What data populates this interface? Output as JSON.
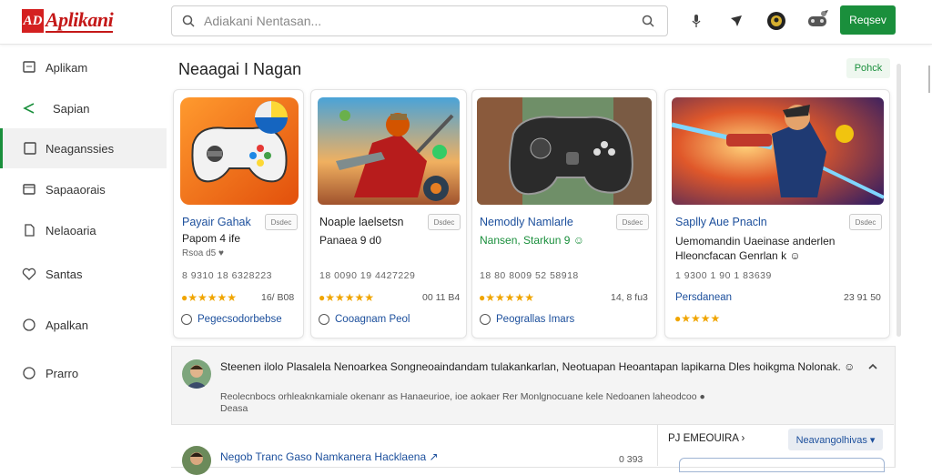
{
  "app": {
    "logo_mark": "AD",
    "logo_text": "Aplikani"
  },
  "search": {
    "placeholder": "Adiakani Nentasan..."
  },
  "topbar": {
    "signin_label": "Reqsev"
  },
  "sidebar": {
    "items": [
      {
        "label": "Aplikam",
        "icon": "square-icon"
      },
      {
        "label": "Sapian",
        "icon": "send-icon"
      },
      {
        "label": "Neaganssies",
        "icon": "square-icon"
      },
      {
        "label": "Sapaaorais",
        "icon": "window-icon"
      },
      {
        "label": "Nelaoaria",
        "icon": "document-icon"
      },
      {
        "label": "Santas",
        "icon": "heart-icon"
      },
      {
        "label": "Apalkan",
        "icon": "circle-icon"
      },
      {
        "label": "Prarro",
        "icon": "circle-icon"
      }
    ],
    "active_index": 2
  },
  "section": {
    "title": "Neaagai I Nagan",
    "more_label": "Pohck"
  },
  "cards": [
    {
      "title": "Payair Gahak",
      "chip": "Dsdec",
      "sub1": "Papom 4 ife",
      "sub2": "Rsoa d5 ♥",
      "meta": "8 9310 18 6328223",
      "rating": "5",
      "rating_text": "16/ B08",
      "link": "Pegecsodorbebse"
    },
    {
      "title": "Noaple laelsetsn",
      "chip": "Dsdec",
      "sub1": "Panaea 9 d0",
      "sub2": "",
      "meta": "18 0090 19 4427229",
      "rating": "5",
      "rating_text": "00 11 B4",
      "link": "Cooagnam Peol"
    },
    {
      "title": "Nemodly Namlarle",
      "chip": "Dsdec",
      "sub1": "Nansen, Starkun 9 ☺",
      "sub2": "",
      "meta": "18 80 8009 52 58918",
      "rating": "5",
      "rating_text": "14, 8 fu3",
      "link": "Peograllas Imars"
    },
    {
      "title": "Saplly Aue Pnacln",
      "chip": "Dsdec",
      "sub1": "Uemomandin Uaeinase anderlen",
      "sub2": "Hleoncfacan Genrlan k ☺",
      "meta": "1 9300 1 90 1 83639",
      "rating": "4",
      "rating_text": "23 91 50",
      "link": "Persdanean"
    }
  ],
  "review": {
    "text": "Steenen ilolo Plasalela Nenoarkea Songneoaindandam tulakankarlan, Neotuapan Heoantapan lapikarna Dles hoikgma Nolonak. ☺",
    "sub": "Reolecnbocs orhleaknkamiale okenanr as Hanaeurioe, ioe aokaer Rer Monlgnocuane kele Nedoanen laheodcoo ●",
    "sub2": "Deasa",
    "second_text": "Negob Tranc Gaso Namkanera Hacklaena ↗",
    "second_meta": "0 393",
    "filter_label": "PJ EMEOUIRA ›",
    "sort_label": "Neavangolhivas ▾"
  },
  "colors": {
    "accent": "#1a8f3c",
    "link": "#1c4f9c",
    "star": "#f0a500",
    "brand_red": "#c41818"
  }
}
